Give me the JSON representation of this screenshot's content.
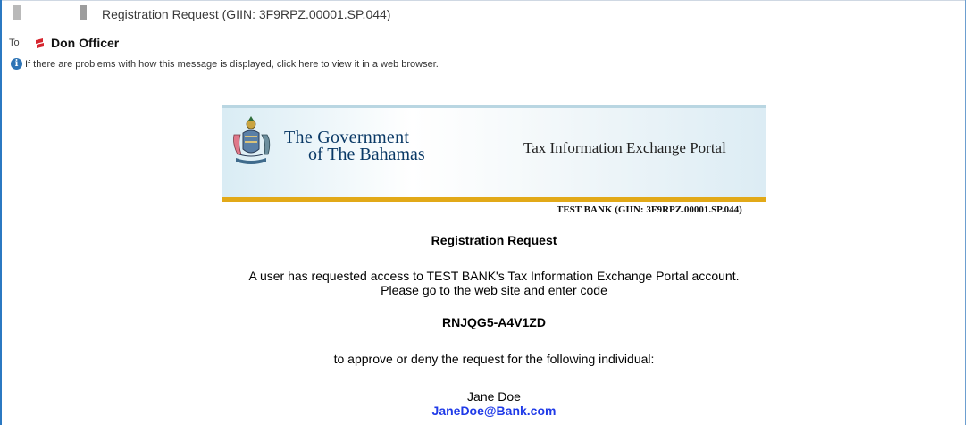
{
  "email": {
    "subject": "Registration Request (GIIN: 3F9RPZ.00001.SP.044)",
    "to_label": "To",
    "recipient": "Don Officer",
    "info_notice": "If there are problems with how this message is displayed, click here to view it in a web browser."
  },
  "banner": {
    "gov_line1": "The Government",
    "gov_line2": "of The Bahamas",
    "portal_title": "Tax Information Exchange Portal",
    "bank_line": "TEST BANK (GIIN: 3F9RPZ.00001.SP.044)"
  },
  "message": {
    "heading": "Registration Request",
    "line1": "A user has requested access to TEST BANK's Tax Information Exchange Portal account.",
    "line2": "Please go to the web site and enter code",
    "code": "RNJQG5-A4V1ZD",
    "line3": "to approve or deny the request for the following individual:",
    "person_name": "Jane Doe",
    "person_email": "JaneDoe@Bank.com"
  },
  "icons": {
    "recipient_icon": "contact-flag-icon",
    "info_icon": "info-icon",
    "crest_icon": "coat-of-arms-icon"
  },
  "colors": {
    "window_border": "#2b79c2",
    "banner_stripe": "#e2a918",
    "gov_title": "#0a3966",
    "link": "#1f3ae8"
  }
}
